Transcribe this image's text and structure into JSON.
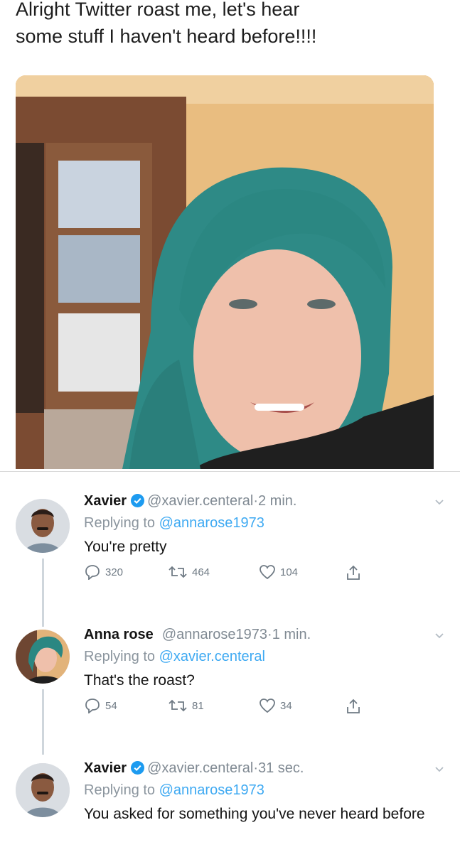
{
  "post": {
    "text": "Alright Twitter roast me, let's hear\nsome stuff I haven't heard before!!!!"
  },
  "replies": [
    {
      "name": "Xavier",
      "handle": "@xavier.centeral",
      "separator": "·",
      "time": "2 min.",
      "replying_prefix": "Replying to ",
      "replying_to": "@annarose1973",
      "text": "You're pretty",
      "replies_count": "320",
      "retweets_count": "464",
      "likes_count": "104"
    },
    {
      "name": "Anna rose",
      "handle": "@annarose1973",
      "separator": "·",
      "time": "1 min.",
      "replying_prefix": "Replying to ",
      "replying_to": "@xavier.centeral",
      "text": "That's the roast?",
      "replies_count": "54",
      "retweets_count": "81",
      "likes_count": "34"
    },
    {
      "name": "Xavier",
      "handle": "@xavier.centeral",
      "separator": "·",
      "time": "31 sec.",
      "replying_prefix": "Replying to ",
      "replying_to": "@annarose1973",
      "text": "You asked for something you've never heard before"
    }
  ],
  "icons": {
    "reply": "reply-icon",
    "retweet": "retweet-icon",
    "like": "like-icon",
    "share": "share-icon",
    "verified": "verified-badge-icon",
    "more": "chevron-down-icon"
  },
  "colors": {
    "link": "#1d9bf0",
    "verified": "#1d9bf0",
    "muted": "#808a93"
  }
}
